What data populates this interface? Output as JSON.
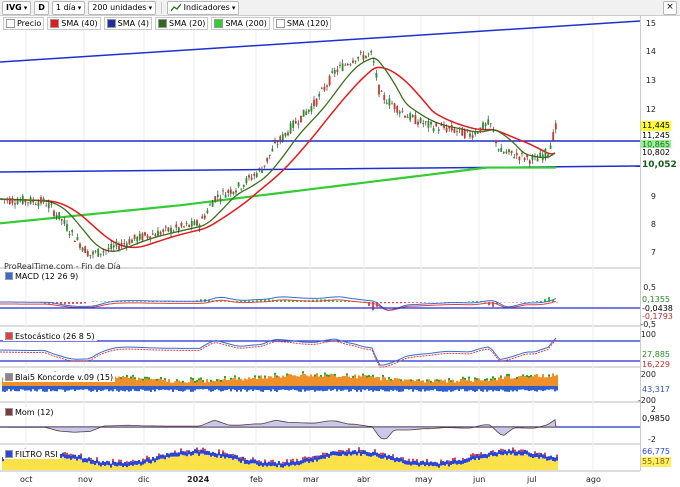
{
  "toolbar": {
    "symbol": "IVG",
    "mode": "D",
    "period": "1 día",
    "units": "200 unidades",
    "indicators": "Indicadores"
  },
  "legend": [
    {
      "label": "Precio",
      "color": "#000000"
    },
    {
      "label": "SMA (40)",
      "color": "#e31a1c"
    },
    {
      "label": "SMA (4)",
      "color": "#1f2f9f"
    },
    {
      "label": "SMA (20)",
      "color": "#2e6b1f"
    },
    {
      "label": "SMA (200)",
      "color": "#33cc33"
    },
    {
      "label": "SMA (120)",
      "color": "#ffffff"
    }
  ],
  "watermark": "ProRealTime.com - Fin de Día",
  "price_axis": {
    "ticks": [
      "15",
      "14",
      "13",
      "12",
      "11",
      "10",
      "9",
      "8",
      "7"
    ],
    "tags": [
      {
        "value": "11,445",
        "bg": "#ffff33"
      },
      {
        "value": "11,245",
        "bg": "#ffffff"
      },
      {
        "value": "10,865",
        "bg": "#99ee99"
      },
      {
        "value": "10,802",
        "bg": "#ffffff"
      },
      {
        "value": "10,052",
        "bg": "#ffffff"
      }
    ]
  },
  "panes": [
    {
      "title": "MACD (12 26 9)",
      "ticks": [
        "0,5",
        "-0,5"
      ],
      "tags": [
        "0,1355",
        "-0,0438",
        "-0,1793"
      ]
    },
    {
      "title": "Estocástico (26 8 5)",
      "ticks": [
        "100"
      ],
      "tags": [
        "27,885",
        "16,229"
      ]
    },
    {
      "title": "Blai5 Koncorde v.09 (15)",
      "ticks": [
        "200",
        "-200"
      ],
      "tags": [
        "43,317"
      ]
    },
    {
      "title": "Mom (12)",
      "ticks": [
        "2",
        "-2"
      ],
      "tags": [
        "0,9850"
      ]
    },
    {
      "title": "FILTRO RSI",
      "ticks": [],
      "tags": [
        "66,775",
        "55,187"
      ]
    }
  ],
  "x_axis": {
    "labels": [
      "oct",
      "nov",
      "dic",
      "2024",
      "feb",
      "mar",
      "abr",
      "may",
      "jun",
      "jul",
      "ago"
    ]
  },
  "colors": {
    "up": "#2e8b2e",
    "down": "#c0392b",
    "trendline": "#1f2fcf",
    "sma40": "#e31a1c",
    "sma20": "#3d6e1e",
    "sma200": "#33cc33"
  }
}
